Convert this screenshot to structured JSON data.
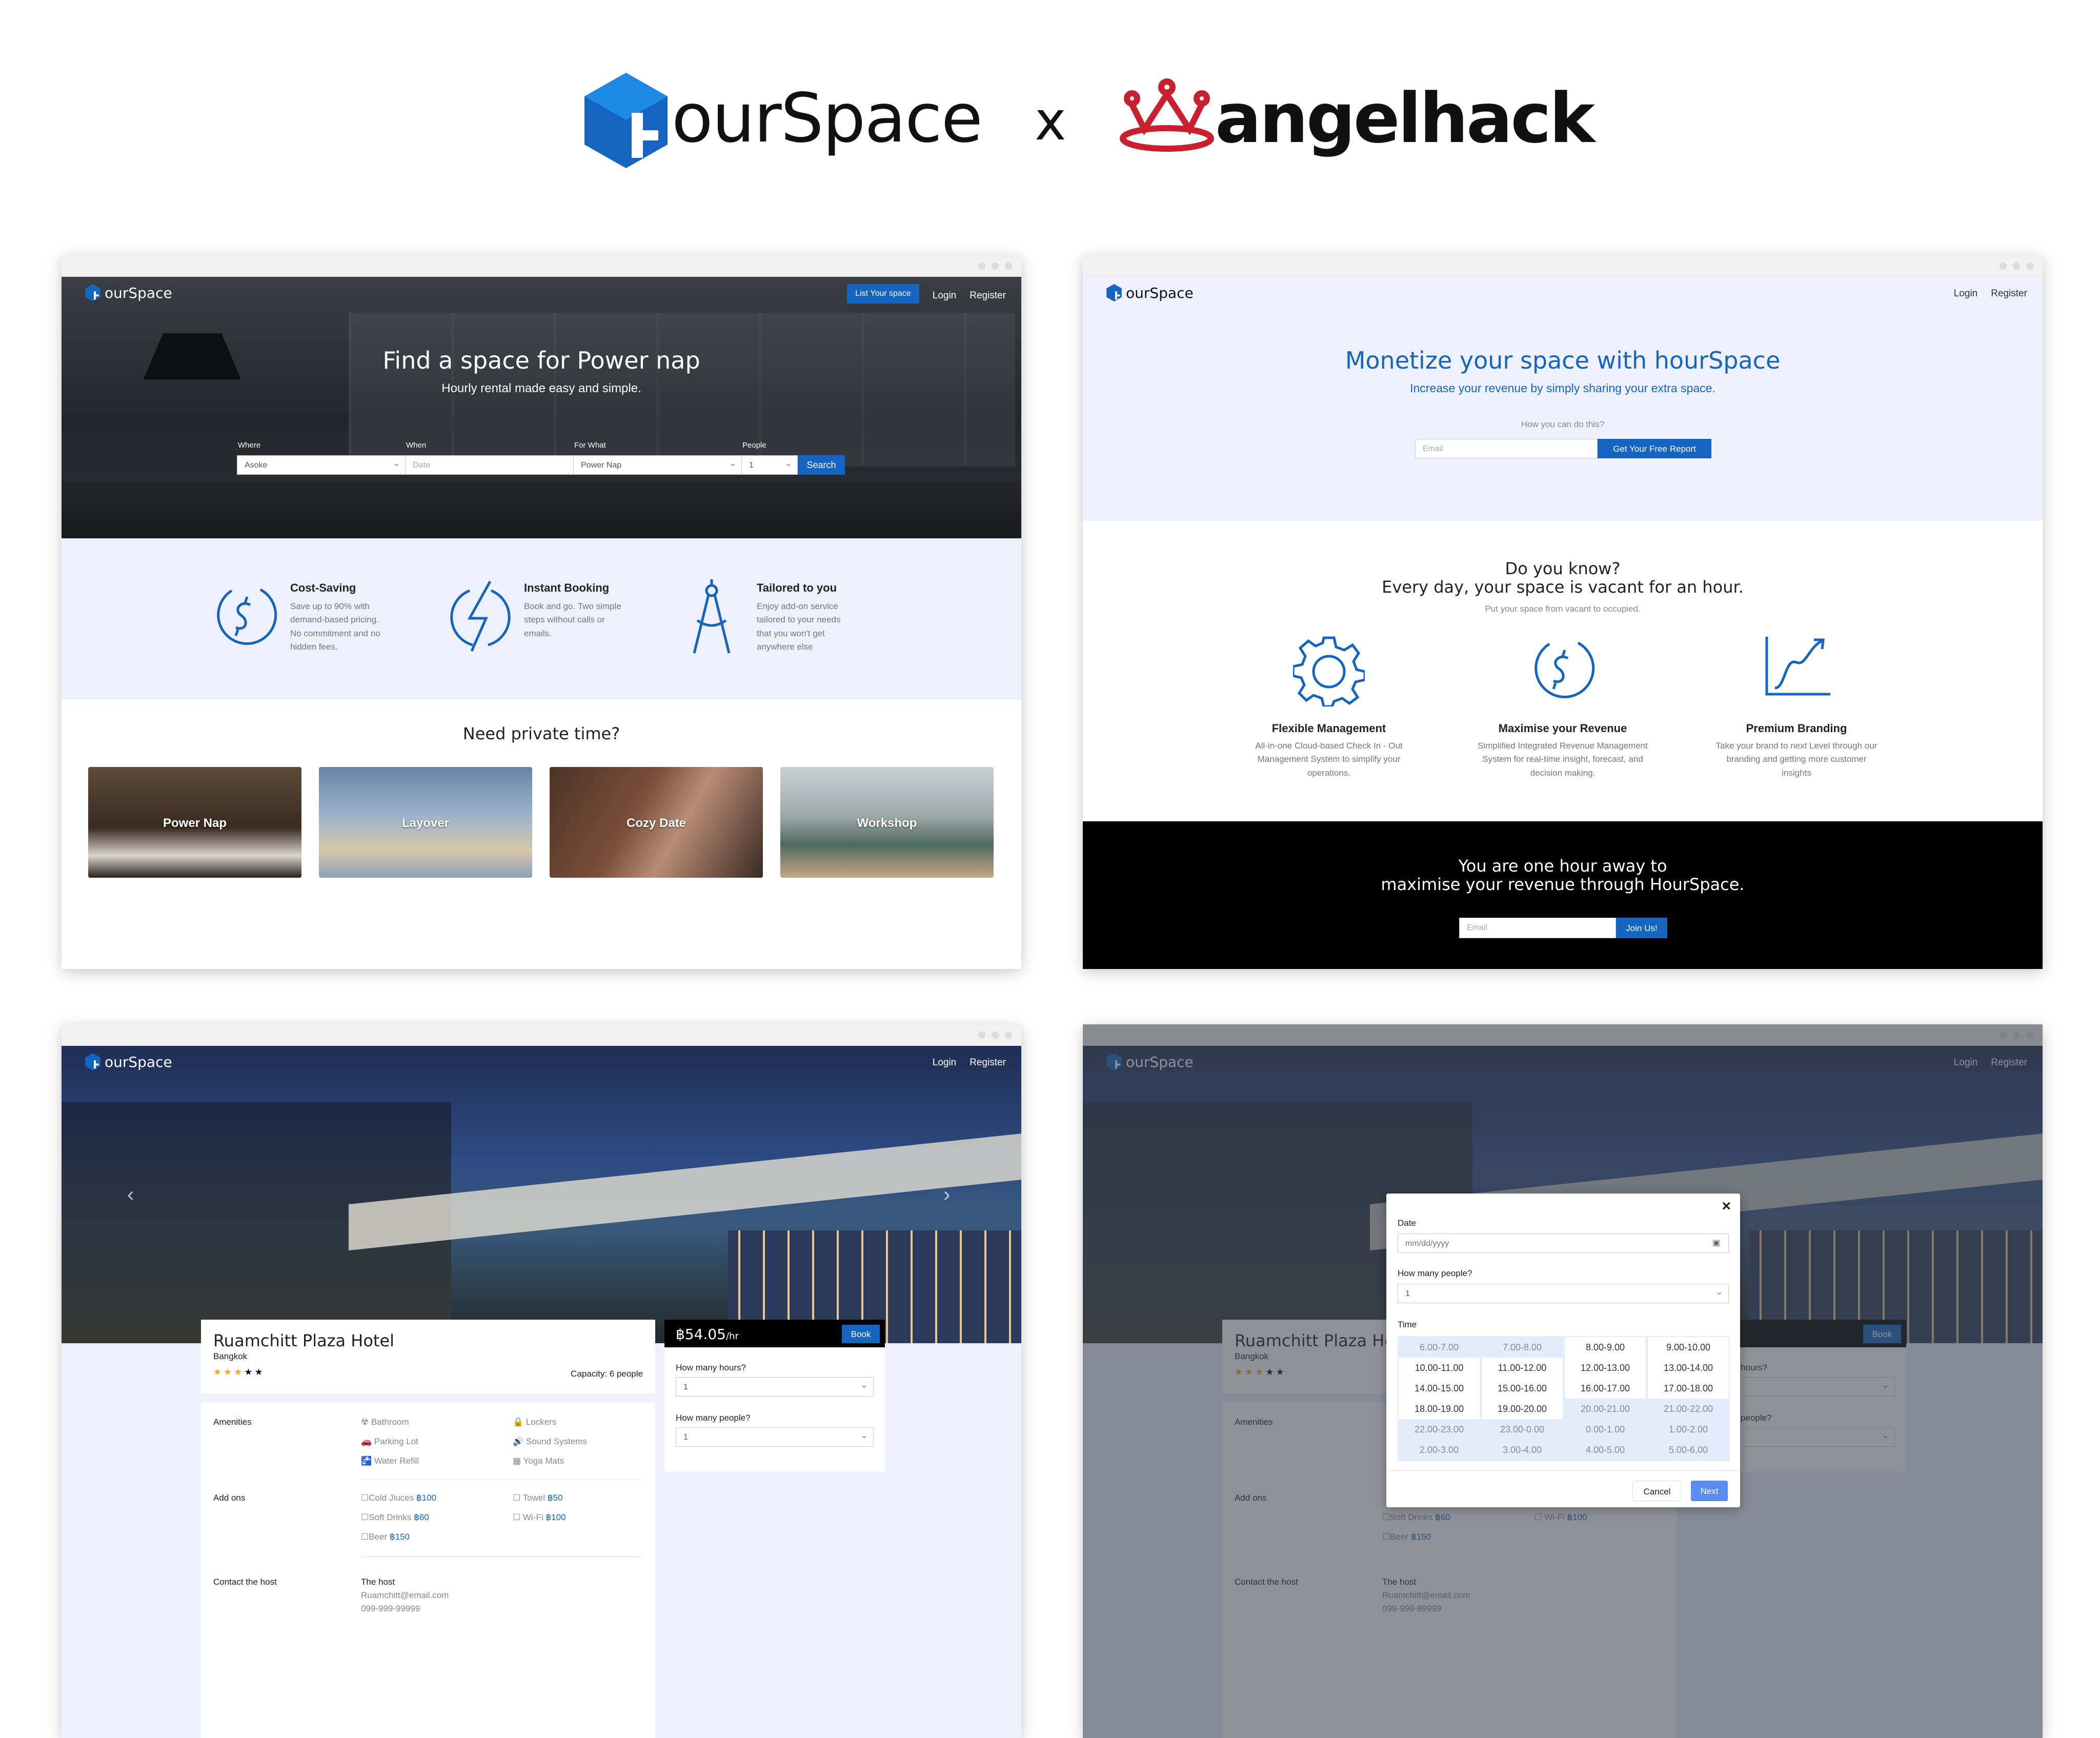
{
  "header": {
    "brand_left": "ourSpace",
    "separator": "x",
    "brand_right": "angelhack",
    "colors": {
      "brand_blue": "#1565c0",
      "angelhack_red": "#c8202f"
    }
  },
  "nav": {
    "logo": "ourSpace",
    "list_space": "List Your space",
    "login": "Login",
    "register": "Register"
  },
  "home": {
    "hero_title": "Find a space for Power nap",
    "hero_subtitle": "Hourly rental made easy and simple.",
    "search": {
      "where_label": "Where",
      "where_value": "Asoke",
      "when_label": "When",
      "when_placeholder": "Date",
      "for_what_label": "For What",
      "for_what_value": "Power Nap",
      "people_label": "People",
      "people_value": "1",
      "search_button": "Search"
    },
    "features": [
      {
        "title": "Cost-Saving",
        "text": [
          "Save up to 90% with",
          "demand-based pricing.",
          "No commitment and no",
          "hidden fees."
        ],
        "icon": "dollar-circle-icon"
      },
      {
        "title": "Instant Booking",
        "text": [
          "Book and go. Two simple",
          "steps without calls or",
          "emails."
        ],
        "icon": "lightning-icon"
      },
      {
        "title": "Tailored to you",
        "text": [
          "Enjoy add-on service",
          "tailored to your needs",
          "that you won't get",
          "anywhere else"
        ],
        "icon": "compass-icon"
      }
    ],
    "section_title": "Need private time?",
    "categories": [
      "Power Nap",
      "Layover",
      "Cozy Date",
      "Workshop"
    ]
  },
  "host": {
    "hero_title": "Monetize your space with hourSpace",
    "hero_subtitle": "Increase your revenue by simply sharing your extra space.",
    "how_label": "How you can do this?",
    "email_placeholder": "Email",
    "report_button": "Get Your Free Report",
    "know_title": "Do you know?",
    "know_subtitle": "Every day, your space is vacant for an hour.",
    "know_caption": "Put your space from vacant to occupied.",
    "benefits": [
      {
        "title": "Flexible Management",
        "text": [
          "All-in-one Cloud-based Check In - Out",
          "Management System to simplify your",
          "operations."
        ],
        "icon": "gear-icon"
      },
      {
        "title": "Maximise your Revenue",
        "text": [
          "Simplified Integrated Revenue Management",
          "System for real-time insight, forecast, and",
          "decision making."
        ],
        "icon": "dollar-circle-icon"
      },
      {
        "title": "Premium Branding",
        "text": [
          "Take your brand to next Level through our",
          "branding and getting more customer",
          "insights"
        ],
        "icon": "growth-chart-icon"
      }
    ],
    "cta_line1": "You are one hour away to",
    "cta_line2": "maximise your revenue through HourSpace.",
    "cta_email_placeholder": "Email",
    "cta_button": "Join Us!"
  },
  "listing": {
    "hotel_name": "Ruamchitt Plaza Hotel",
    "city": "Bangkok",
    "rating_stars": 3,
    "rating_max": 5,
    "capacity": "Capacity: 6 people",
    "price": "฿54.05",
    "price_unit": "/hr",
    "book_button": "Book",
    "hours_label": "How many hours?",
    "hours_value": "1",
    "people_label": "How many people?",
    "people_value": "1",
    "amenities_label": "Amenities",
    "amenities": [
      "Bathroom",
      "Lockers",
      "Parking Lot",
      "Sound Systems",
      "Water Refill",
      "Yoga Mats"
    ],
    "addons_label": "Add ons",
    "addons": [
      {
        "name": "Cold Jiuces",
        "price": "฿100"
      },
      {
        "name": "Towel",
        "price": "฿50"
      },
      {
        "name": "Soft Drinks",
        "price": "฿60"
      },
      {
        "name": "Wi-Fi",
        "price": "฿100"
      },
      {
        "name": "Beer",
        "price": "฿150"
      }
    ],
    "contact_label": "Contact the host",
    "host_name": "The host",
    "host_email": "Ruamchitt@email.com",
    "host_phone": "099-999-99999"
  },
  "modal": {
    "close": "×",
    "date_label": "Date",
    "date_placeholder": "mm/dd/yyyy",
    "people_label": "How many people?",
    "people_value": "1",
    "time_label": "Time",
    "slots": [
      {
        "t": "6.00-7.00",
        "na": true
      },
      {
        "t": "7.00-8.00",
        "na": true
      },
      {
        "t": "8.00-9.00",
        "na": false
      },
      {
        "t": "9.00-10.00",
        "na": false
      },
      {
        "t": "10.00-11.00",
        "na": false
      },
      {
        "t": "11.00-12.00",
        "na": false
      },
      {
        "t": "12.00-13.00",
        "na": false
      },
      {
        "t": "13.00-14.00",
        "na": false
      },
      {
        "t": "14.00-15.00",
        "na": false
      },
      {
        "t": "15.00-16.00",
        "na": false
      },
      {
        "t": "16.00-17.00",
        "na": false
      },
      {
        "t": "17.00-18.00",
        "na": false
      },
      {
        "t": "18.00-19.00",
        "na": false
      },
      {
        "t": "19.00-20.00",
        "na": false
      },
      {
        "t": "20.00-21.00",
        "na": true
      },
      {
        "t": "21.00-22.00",
        "na": true
      },
      {
        "t": "22.00-23.00",
        "na": true
      },
      {
        "t": "23.00-0.00",
        "na": true
      },
      {
        "t": "0.00-1.00",
        "na": true
      },
      {
        "t": "1.00-2.00",
        "na": true
      },
      {
        "t": "2.00-3.00",
        "na": true
      },
      {
        "t": "3.00-4.00",
        "na": true
      },
      {
        "t": "4.00-5.00",
        "na": true
      },
      {
        "t": "5.00-6.00",
        "na": true
      }
    ],
    "cancel": "Cancel",
    "next": "Next"
  }
}
